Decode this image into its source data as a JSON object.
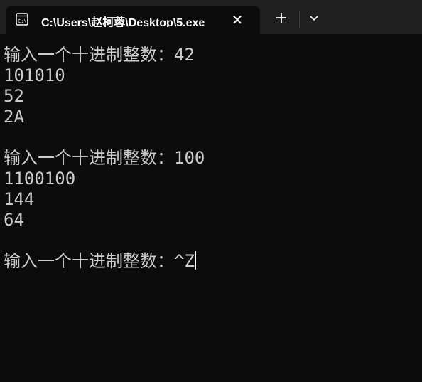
{
  "tab": {
    "title": "C:\\Users\\赵柯蓉\\Desktop\\5.exe",
    "icon": "console-app-icon",
    "close_glyph": "✕"
  },
  "toolbar": {
    "new_tab_glyph": "+",
    "dropdown_icon": "chevron-down-icon"
  },
  "console": {
    "lines": [
      "输入一个十进制整数：42",
      "101010",
      "52",
      "2A",
      "",
      "输入一个十进制整数：100",
      "1100100",
      "144",
      "64",
      "",
      "输入一个十进制整数：^Z"
    ]
  },
  "colors": {
    "background": "#0c0c0c",
    "titlebar": "#202020",
    "text": "#cccccc"
  }
}
